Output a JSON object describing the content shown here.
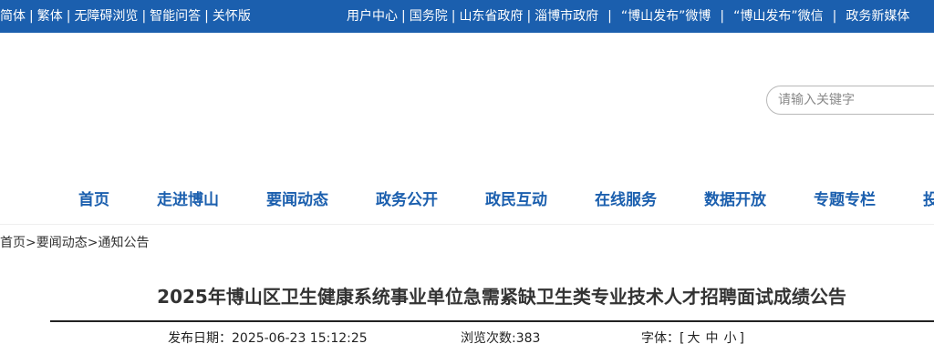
{
  "topbar": {
    "left_links": [
      "简体",
      "繁体",
      "无障碍浏览",
      "智能问答",
      "关怀版"
    ],
    "right_links": [
      "用户中心",
      "国务院",
      "山东省政府",
      "淄博市政府",
      "“博山发布”微博",
      "“博山发布”微信",
      "政务新媒体"
    ]
  },
  "search": {
    "placeholder": "请输入关键字"
  },
  "nav": {
    "items": [
      "首页",
      "走进博山",
      "要闻动态",
      "政务公开",
      "政民互动",
      "在线服务",
      "数据开放",
      "专题专栏",
      "投"
    ]
  },
  "breadcrumb": {
    "items": [
      "首页",
      "要闻动态",
      "通知公告"
    ],
    "separator": ">"
  },
  "article": {
    "title": "2025年博山区卫生健康系统事业单位急需紧缺卫生类专业技术人才招聘面试成绩公告",
    "publish_label": "发布日期：",
    "publish_date": "2025-06-23 15:12:25",
    "views_label": "浏览次数:",
    "views": "383",
    "font_label": "字体：",
    "font_open": "[",
    "font_sizes": [
      "大",
      "中",
      "小"
    ],
    "font_close": "]"
  },
  "colors": {
    "brand_blue": "#1b5fae"
  }
}
